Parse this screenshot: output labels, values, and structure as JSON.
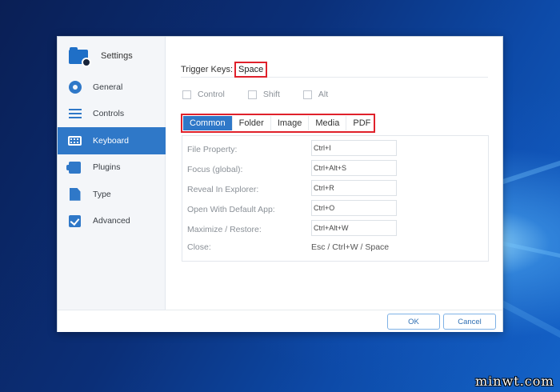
{
  "app": {
    "title": "Settings"
  },
  "sidebar": {
    "items": [
      {
        "label": "General",
        "icon": "gear-icon"
      },
      {
        "label": "Controls",
        "icon": "sliders-icon"
      },
      {
        "label": "Keyboard",
        "icon": "keyboard-icon",
        "active": true
      },
      {
        "label": "Plugins",
        "icon": "plugin-icon"
      },
      {
        "label": "Type",
        "icon": "document-icon"
      },
      {
        "label": "Advanced",
        "icon": "checkbox-icon"
      }
    ]
  },
  "trigger": {
    "label": "Trigger Keys:",
    "value": "Space"
  },
  "modifiers": [
    {
      "label": "Control",
      "checked": false
    },
    {
      "label": "Shift",
      "checked": false
    },
    {
      "label": "Alt",
      "checked": false
    }
  ],
  "tabs": [
    {
      "label": "Common",
      "active": true
    },
    {
      "label": "Folder"
    },
    {
      "label": "Image"
    },
    {
      "label": "Media"
    },
    {
      "label": "PDF"
    }
  ],
  "shortcuts": [
    {
      "label": "File Property:",
      "value": "Ctrl+I"
    },
    {
      "label": "Focus (global):",
      "value": "Ctrl+Alt+S"
    },
    {
      "label": "Reveal In Explorer:",
      "value": "Ctrl+R"
    },
    {
      "label": "Open With Default App:",
      "value": "Ctrl+O"
    },
    {
      "label": "Maximize / Restore:",
      "value": "Ctrl+Alt+W"
    },
    {
      "label": "Close:",
      "value": "Esc / Ctrl+W / Space"
    }
  ],
  "footer": {
    "ok_label": "OK",
    "cancel_label": "Cancel"
  },
  "watermark": "minwt.com",
  "colors": {
    "accent": "#2f78c8",
    "highlight_box": "#e0212b"
  }
}
